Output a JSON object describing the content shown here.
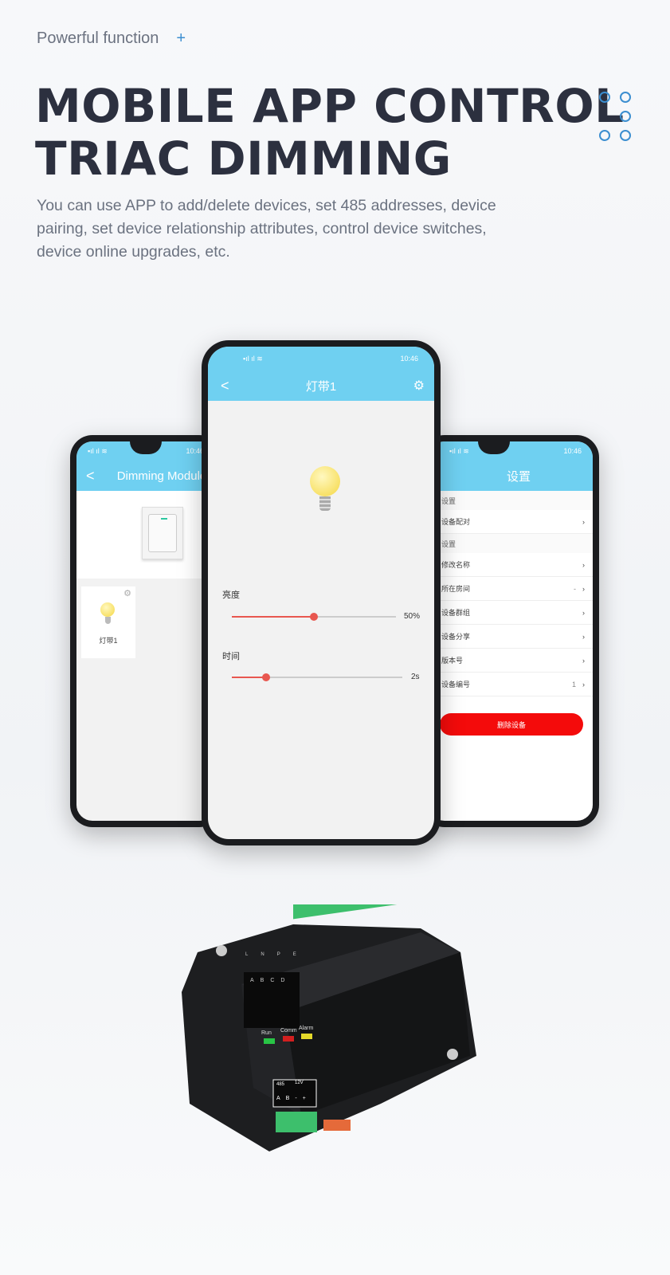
{
  "header": {
    "kicker": "Powerful function",
    "plus": "+",
    "title_line1": "MOBILE APP CONTROL",
    "title_line2": "TRIAC DIMMING",
    "description": "You can use APP to add/delete devices, set 485 addresses, device pairing, set device relationship attributes, control device switches, device online upgrades, etc."
  },
  "colors": {
    "accent": "#3b8ed0",
    "app_bar": "#6fd0f1",
    "slider": "#e8574f",
    "delete": "#f40b0b"
  },
  "left_phone": {
    "time": "10:46",
    "title": "Dimming Module",
    "back": "<",
    "device_card": {
      "label": "灯带1"
    }
  },
  "center_phone": {
    "time": "10:46",
    "title": "灯带1",
    "back": "<",
    "brightness": {
      "label": "亮度",
      "value_text": "50%",
      "value": 50
    },
    "time_setting": {
      "label": "时间",
      "value_text": "2s",
      "value": 0.2
    }
  },
  "right_phone": {
    "time": "10:46",
    "title": "设置",
    "sections": [
      {
        "header": "设置",
        "items": [
          {
            "label": "设备配对",
            "value": ""
          }
        ]
      },
      {
        "header": "设置",
        "items": [
          {
            "label": "修改名称",
            "value": ""
          },
          {
            "label": "所在房间",
            "value": "-"
          },
          {
            "label": "设备群组",
            "value": ""
          },
          {
            "label": "设备分享",
            "value": ""
          },
          {
            "label": "版本号",
            "value": ""
          },
          {
            "label": "设备编号",
            "value": "1"
          }
        ]
      }
    ],
    "delete_button": "删除设备"
  },
  "device": {
    "leds": [
      "Run",
      "Comm",
      "Alarm"
    ],
    "channels": [
      "A",
      "B",
      "C",
      "D"
    ],
    "port_485": "485",
    "port_12v": "12V",
    "pins": [
      "A",
      "B",
      "-",
      "+"
    ],
    "terminals_top": [
      "L",
      "N",
      "PE"
    ]
  }
}
